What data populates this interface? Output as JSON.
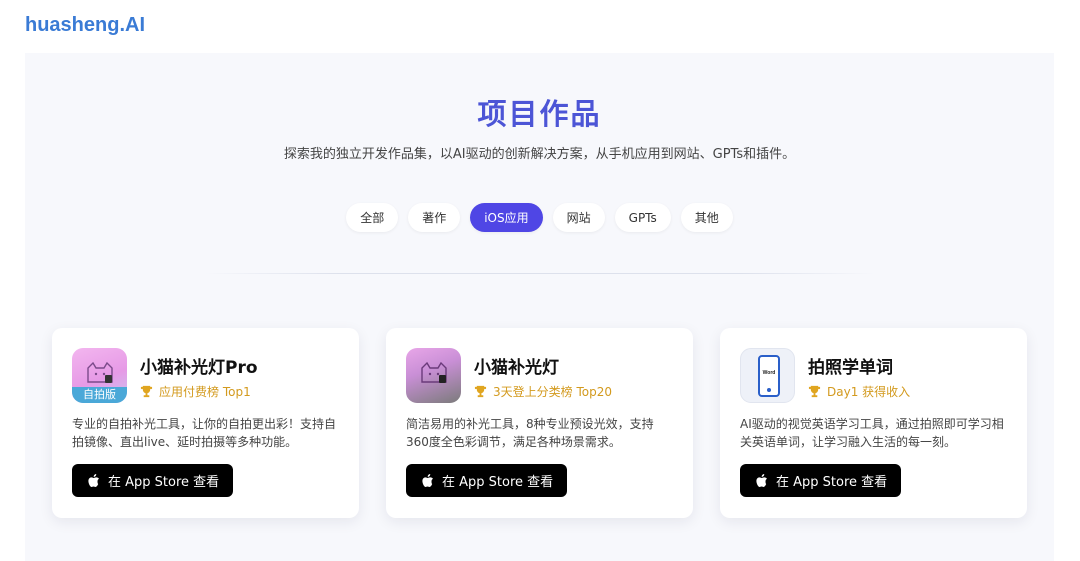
{
  "header": {
    "logo": "huasheng.AI"
  },
  "hero": {
    "title": "项目作品",
    "subtitle": "探索我的独立开发作品集，以AI驱动的创新解决方案，从手机应用到网站、GPTs和插件。"
  },
  "filters": [
    {
      "label": "全部",
      "active": false
    },
    {
      "label": "著作",
      "active": false
    },
    {
      "label": "iOS应用",
      "active": true
    },
    {
      "label": "网站",
      "active": false
    },
    {
      "label": "GPTs",
      "active": false
    },
    {
      "label": "其他",
      "active": false
    }
  ],
  "cards": [
    {
      "title": "小猫补光灯Pro",
      "icon": "cat-icon",
      "icon_ribbon": "自拍版",
      "badge": "应用付费榜 Top1",
      "description": "专业的自拍补光工具，让你的自拍更出彩！支持自拍镜像、直出live、延时拍摄等多种功能。",
      "button_label": "在 App Store 查看"
    },
    {
      "title": "小猫补光灯",
      "icon": "cat-icon",
      "badge": "3天登上分类榜 Top20",
      "description": "简洁易用的补光工具，8种专业预设光效，支持360度全色彩调节，满足各种场景需求。",
      "button_label": "在 App Store 查看"
    },
    {
      "title": "拍照学单词",
      "icon": "phone-icon",
      "icon_text": "Word",
      "badge": "Day1 获得收入",
      "description": "AI驱动的视觉英语学习工具，通过拍照即可学习相关英语单词，让学习融入生活的每一刻。",
      "button_label": "在 App Store 查看"
    }
  ],
  "colors": {
    "brand": "#3a7bd5",
    "title": "#4c55d6",
    "active_filter": "#4f46e5",
    "badge": "#d39a1e"
  }
}
